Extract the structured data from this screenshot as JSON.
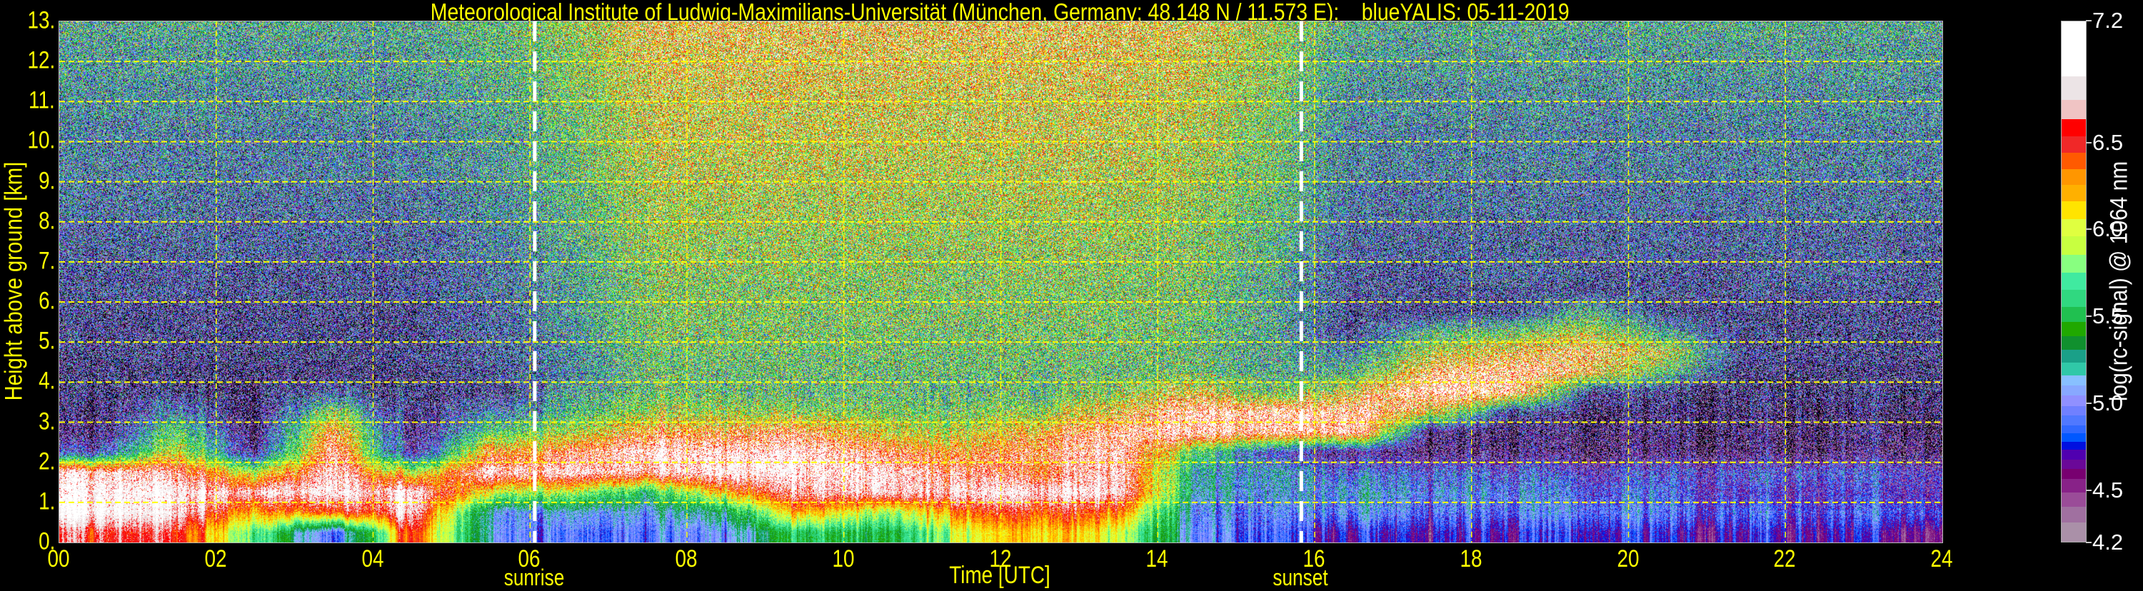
{
  "chart_data": {
    "type": "heatmap",
    "title": "Meteorological Institute of Ludwig-Maximilians-Universität (München, Germany; 48.148 N / 11.573 E):    blueYALIS: 05-11-2019",
    "xlabel": "Time [UTC]",
    "ylabel": "Height above ground [km]",
    "colorbar_label": "log(rc-signal) @ 1064 nm",
    "xlim": [
      0,
      24
    ],
    "ylim": [
      0,
      13
    ],
    "grid": true,
    "grid_color": "#ffff00",
    "x_ticks": [
      {
        "value": 0,
        "label": "00"
      },
      {
        "value": 2,
        "label": "02"
      },
      {
        "value": 4,
        "label": "04"
      },
      {
        "value": 6,
        "label": "06"
      },
      {
        "value": 8,
        "label": "08"
      },
      {
        "value": 10,
        "label": "10"
      },
      {
        "value": 12,
        "label": "12"
      },
      {
        "value": 14,
        "label": "14"
      },
      {
        "value": 16,
        "label": "16"
      },
      {
        "value": 18,
        "label": "18"
      },
      {
        "value": 20,
        "label": "20"
      },
      {
        "value": 22,
        "label": "22"
      },
      {
        "value": 24,
        "label": "24"
      }
    ],
    "y_ticks": [
      {
        "value": 0,
        "label": "0."
      },
      {
        "value": 1,
        "label": "1."
      },
      {
        "value": 2,
        "label": "2."
      },
      {
        "value": 3,
        "label": "3."
      },
      {
        "value": 4,
        "label": "4."
      },
      {
        "value": 5,
        "label": "5."
      },
      {
        "value": 6,
        "label": "6."
      },
      {
        "value": 7,
        "label": "7."
      },
      {
        "value": 8,
        "label": "8."
      },
      {
        "value": 9,
        "label": "9."
      },
      {
        "value": 10,
        "label": "10."
      },
      {
        "value": 11,
        "label": "11."
      },
      {
        "value": 12,
        "label": "12."
      },
      {
        "value": 13,
        "label": "13."
      }
    ],
    "annotations": [
      {
        "label": "sunrise",
        "x": 6.06,
        "style": "white-dashed-vertical"
      },
      {
        "label": "sunset",
        "x": 15.83,
        "style": "white-dashed-vertical"
      }
    ],
    "colorbar": {
      "range": [
        4.2,
        7.2
      ],
      "ticks": [
        {
          "value": 4.2,
          "label": "4.2"
        },
        {
          "value": 4.5,
          "label": "4.5"
        },
        {
          "value": 5.0,
          "label": "5.0"
        },
        {
          "value": 5.5,
          "label": "5.5"
        },
        {
          "value": 6.0,
          "label": "6.0"
        },
        {
          "value": 6.5,
          "label": "6.5"
        },
        {
          "value": 7.2,
          "label": "7.2"
        }
      ],
      "boundaries": [
        4.2,
        4.319,
        4.412,
        4.494,
        4.57,
        4.628,
        4.684,
        4.738,
        4.786,
        4.835,
        4.88,
        4.935,
        4.991,
        5.05,
        5.11,
        5.168,
        5.24,
        5.315,
        5.391,
        5.475,
        5.562,
        5.657,
        5.758,
        5.858,
        5.966,
        6.065,
        6.167,
        6.262,
        6.353,
        6.448,
        6.54,
        6.64,
        6.75,
        6.887,
        7.2
      ],
      "colors": [
        "#aa90a8",
        "#a070a0",
        "#9a4c98",
        "#882288",
        "#780070",
        "#6a0898",
        "#5000b0",
        "#0010e0",
        "#0058ff",
        "#3068ff",
        "#5078ff",
        "#7080ff",
        "#9090ff",
        "#88a8ff",
        "#88c0ff",
        "#30c8a8",
        "#1aa088",
        "#10902e",
        "#20a800",
        "#20c050",
        "#30d880",
        "#40eaa0",
        "#88ff80",
        "#c8ff40",
        "#e0ff40",
        "#ffe400",
        "#ffb000",
        "#ff9600",
        "#ff5a00",
        "#f02828",
        "#ff0000",
        "#f0c4c4",
        "#ece4e6",
        "#ffffff"
      ],
      "under_color": "#000000",
      "over_color": "#ffffff"
    },
    "z": {
      "times": [
        0.5,
        1.5,
        2.5,
        3.5,
        4.5,
        5.5,
        6.5,
        7.5,
        8.5,
        9.5,
        10.5,
        11.5,
        12.5,
        13.5,
        14.5,
        15.5,
        16.5,
        17.5,
        18.5,
        19.5,
        20.5,
        21.5,
        22.5,
        23.5
      ],
      "heights": [
        0.25,
        0.75,
        1.25,
        1.75,
        2.25,
        2.75,
        3.25,
        3.75,
        4.25,
        4.75,
        5.25,
        5.75,
        6.25,
        6.75,
        7.25,
        7.75,
        8.25,
        8.75,
        9.25,
        9.75,
        10.25,
        10.75,
        11.25,
        11.75,
        12.25,
        12.75
      ],
      "values": [
        [
          6.6,
          6.5,
          5.8,
          4.8,
          6.5,
          5.1,
          4.9,
          4.95,
          5.0,
          5.6,
          5.4,
          6.0,
          6.2,
          6.0,
          5.0,
          4.9,
          4.7,
          4.7,
          4.7,
          4.8,
          4.7,
          4.7,
          4.7,
          4.6
        ],
        [
          7.0,
          6.8,
          6.3,
          6.4,
          6.8,
          5.1,
          5.1,
          5.1,
          5.3,
          6.3,
          5.8,
          6.4,
          6.5,
          6.4,
          5.0,
          5.0,
          5.0,
          4.9,
          4.9,
          5.0,
          4.9,
          4.9,
          4.85,
          4.85
        ],
        [
          7.0,
          6.9,
          6.9,
          6.9,
          6.9,
          6.0,
          5.9,
          5.5,
          6.2,
          6.8,
          6.8,
          6.9,
          6.9,
          6.9,
          5.2,
          5.1,
          5.1,
          5.0,
          5.0,
          4.9,
          4.9,
          4.7,
          4.75,
          4.7
        ],
        [
          6.9,
          6.7,
          6.0,
          6.9,
          5.9,
          6.9,
          6.9,
          6.8,
          7.0,
          7.0,
          6.9,
          6.7,
          6.5,
          6.9,
          5.2,
          5.2,
          4.9,
          4.9,
          4.85,
          4.75,
          4.8,
          4.85,
          4.9,
          4.75
        ],
        [
          4.8,
          6.0,
          4.6,
          6.8,
          4.5,
          6.4,
          6.6,
          7.0,
          6.9,
          7.0,
          6.6,
          6.4,
          6.6,
          6.9,
          5.6,
          4.8,
          4.5,
          4.4,
          4.4,
          4.4,
          4.4,
          4.4,
          4.4,
          4.4
        ],
        [
          4.4,
          5.6,
          4.4,
          6.5,
          4.4,
          5.6,
          5.9,
          6.5,
          6.4,
          6.6,
          6.0,
          6.0,
          6.3,
          6.8,
          6.9,
          6.8,
          6.9,
          4.4,
          4.4,
          4.4,
          4.4,
          4.4,
          4.4,
          4.4
        ],
        [
          4.4,
          5.0,
          4.4,
          5.8,
          4.4,
          5.0,
          5.4,
          5.9,
          5.8,
          5.8,
          5.7,
          5.7,
          5.8,
          6.3,
          6.9,
          6.9,
          6.8,
          6.2,
          4.6,
          4.4,
          4.4,
          4.4,
          4.4,
          4.4
        ],
        [
          4.5,
          4.5,
          4.5,
          4.8,
          4.5,
          4.6,
          5.2,
          5.6,
          5.5,
          5.5,
          5.5,
          5.5,
          5.5,
          5.8,
          6.2,
          5.6,
          6.2,
          7.0,
          6.8,
          4.7,
          4.5,
          4.5,
          4.5,
          4.5
        ],
        [
          4.5,
          4.5,
          4.5,
          4.5,
          4.5,
          4.7,
          5.05,
          5.55,
          5.55,
          5.55,
          5.55,
          5.55,
          5.55,
          5.55,
          5.6,
          5.3,
          5.4,
          6.6,
          6.8,
          6.4,
          5.5,
          4.5,
          4.5,
          4.5
        ],
        [
          4.6,
          4.6,
          4.6,
          4.6,
          4.6,
          4.8,
          5.1,
          5.6,
          5.6,
          5.6,
          5.6,
          5.6,
          5.6,
          5.6,
          5.5,
          5.3,
          5.0,
          6.0,
          6.3,
          6.5,
          6.0,
          4.6,
          4.6,
          4.6
        ],
        [
          4.6,
          4.6,
          4.6,
          4.6,
          4.6,
          4.8,
          5.15,
          5.65,
          5.65,
          5.65,
          5.65,
          5.65,
          5.65,
          5.65,
          5.55,
          5.3,
          4.6,
          5.4,
          5.6,
          6.0,
          5.2,
          4.6,
          4.6,
          4.6
        ],
        [
          4.6,
          4.6,
          4.6,
          4.6,
          4.6,
          4.8,
          5.2,
          5.7,
          5.7,
          5.7,
          5.7,
          5.7,
          5.7,
          5.7,
          5.6,
          5.35,
          4.6,
          4.6,
          4.6,
          5.4,
          4.6,
          4.6,
          4.6,
          4.6
        ],
        [
          4.7,
          4.7,
          4.7,
          4.7,
          4.7,
          4.9,
          5.2,
          5.7,
          5.7,
          5.7,
          5.7,
          5.7,
          5.7,
          5.7,
          5.6,
          5.3,
          4.7,
          4.7,
          4.7,
          4.7,
          4.7,
          4.7,
          4.7,
          4.7
        ],
        [
          4.7,
          4.7,
          4.7,
          4.7,
          4.7,
          4.9,
          5.25,
          5.75,
          5.75,
          5.75,
          5.75,
          5.75,
          5.75,
          5.75,
          5.65,
          5.35,
          4.7,
          4.7,
          4.9,
          4.7,
          4.7,
          4.7,
          4.9,
          4.7
        ],
        [
          4.8,
          4.8,
          4.8,
          4.8,
          4.8,
          5.0,
          5.3,
          5.8,
          5.8,
          5.8,
          5.8,
          5.8,
          5.8,
          5.8,
          5.7,
          5.4,
          4.8,
          4.8,
          4.8,
          4.8,
          4.8,
          4.8,
          4.8,
          4.8
        ],
        [
          4.8,
          4.8,
          4.8,
          4.8,
          4.8,
          5.0,
          5.35,
          5.85,
          5.85,
          5.85,
          5.85,
          5.85,
          5.85,
          5.85,
          5.75,
          5.45,
          4.8,
          4.8,
          4.8,
          4.8,
          4.8,
          4.8,
          4.8,
          4.8
        ],
        [
          4.9,
          4.9,
          4.9,
          4.9,
          4.9,
          5.1,
          5.4,
          5.9,
          5.9,
          5.9,
          5.9,
          5.9,
          5.9,
          5.9,
          5.8,
          5.5,
          4.9,
          4.9,
          4.9,
          4.9,
          4.9,
          4.9,
          4.9,
          4.9
        ],
        [
          4.9,
          4.9,
          4.9,
          4.9,
          4.9,
          5.1,
          5.45,
          5.95,
          5.95,
          5.95,
          5.95,
          5.95,
          5.95,
          5.95,
          5.85,
          5.55,
          4.9,
          4.9,
          4.9,
          4.9,
          4.9,
          4.9,
          4.9,
          4.9
        ],
        [
          5.0,
          5.0,
          5.0,
          5.0,
          5.0,
          5.2,
          5.5,
          6.0,
          6.0,
          6.0,
          6.0,
          6.0,
          6.0,
          6.0,
          5.9,
          5.6,
          5.0,
          5.0,
          5.0,
          5.0,
          5.0,
          5.0,
          5.0,
          5.0
        ],
        [
          5.0,
          5.0,
          5.0,
          5.0,
          5.0,
          5.2,
          5.5,
          6.05,
          6.05,
          6.05,
          6.05,
          6.05,
          6.05,
          6.05,
          5.95,
          5.6,
          5.0,
          5.0,
          5.0,
          5.0,
          5.0,
          5.0,
          5.0,
          5.0
        ],
        [
          5.0,
          5.0,
          5.0,
          5.0,
          5.0,
          5.2,
          5.55,
          6.1,
          6.1,
          6.1,
          6.1,
          6.1,
          6.1,
          6.1,
          6.0,
          5.65,
          5.0,
          5.0,
          5.0,
          5.0,
          5.0,
          5.0,
          5.0,
          5.0
        ],
        [
          5.1,
          5.1,
          5.1,
          5.1,
          5.1,
          5.3,
          5.6,
          6.1,
          6.1,
          6.1,
          6.1,
          6.1,
          6.1,
          6.1,
          6.0,
          5.7,
          5.1,
          5.1,
          5.1,
          5.1,
          5.1,
          5.1,
          5.1,
          5.1
        ],
        [
          5.1,
          5.1,
          5.1,
          5.1,
          5.1,
          5.3,
          5.65,
          6.15,
          6.15,
          6.15,
          6.15,
          6.15,
          6.15,
          6.15,
          6.05,
          5.75,
          5.1,
          5.1,
          5.1,
          5.1,
          5.1,
          5.1,
          5.1,
          5.1
        ],
        [
          5.2,
          5.2,
          5.2,
          5.2,
          5.2,
          5.4,
          5.7,
          6.2,
          6.2,
          6.2,
          6.2,
          6.2,
          6.2,
          6.2,
          6.1,
          5.8,
          5.2,
          5.2,
          5.2,
          5.2,
          5.2,
          5.2,
          5.2,
          5.2
        ],
        [
          5.2,
          5.2,
          5.2,
          5.2,
          5.2,
          5.4,
          5.7,
          6.25,
          6.25,
          6.25,
          6.25,
          6.25,
          6.25,
          6.25,
          6.15,
          5.8,
          5.2,
          5.2,
          5.2,
          5.2,
          5.2,
          5.2,
          5.2,
          5.2
        ],
        [
          5.3,
          5.3,
          5.3,
          5.3,
          5.3,
          5.5,
          5.8,
          6.3,
          6.3,
          6.3,
          6.3,
          6.3,
          6.3,
          6.3,
          6.2,
          5.9,
          5.3,
          5.3,
          5.3,
          5.3,
          5.3,
          5.3,
          5.3,
          5.3
        ]
      ]
    }
  }
}
